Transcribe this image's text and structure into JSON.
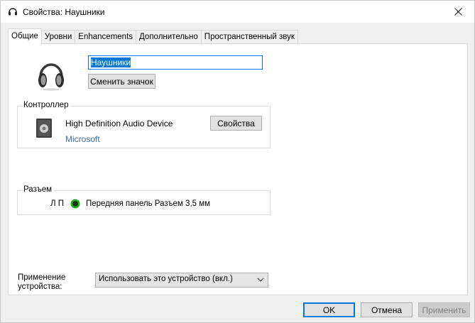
{
  "window": {
    "title": "Свойства: Наушники"
  },
  "tabs": [
    {
      "label": "Общие",
      "active": true
    },
    {
      "label": "Уровни"
    },
    {
      "label": "Enhancements"
    },
    {
      "label": "Дополнительно"
    },
    {
      "label": "Пространственный звук"
    }
  ],
  "general": {
    "device_name_value": "Наушники",
    "change_icon_label": "Сменить значок"
  },
  "controller": {
    "group_label": "Контроллер",
    "device": "High Definition Audio Device",
    "vendor": "Microsoft",
    "properties_label": "Свойства"
  },
  "jack": {
    "group_label": "Разъем",
    "channels": "Л П",
    "description": "Передняя панель Разъем 3,5 мм",
    "dot_color": "#1db31d"
  },
  "usage": {
    "label_line1": "Применение",
    "label_line2": "устройства:",
    "selected": "Использовать это устройство (вкл.)"
  },
  "buttons": {
    "ok": "OK",
    "cancel": "Отмена",
    "apply": "Применить"
  },
  "colors": {
    "accent": "#0078d7",
    "link": "#3c6ea6"
  },
  "icons": [
    "headset-icon",
    "close-icon",
    "headphones-icon",
    "audio-device-icon",
    "jack-indicator-icon",
    "chevron-down-icon"
  ]
}
